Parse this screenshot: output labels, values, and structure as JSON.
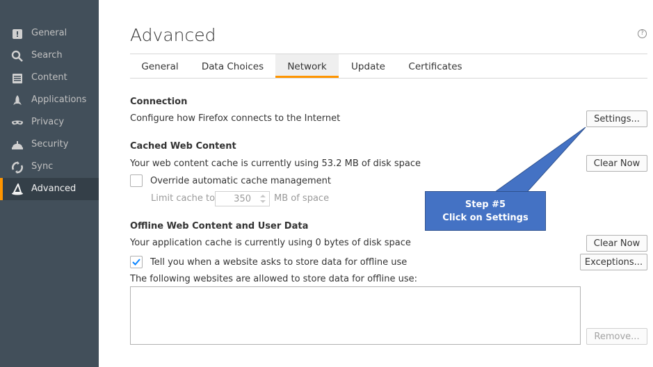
{
  "sidebar": {
    "items": [
      {
        "label": "General",
        "icon": "general-icon"
      },
      {
        "label": "Search",
        "icon": "search-icon"
      },
      {
        "label": "Content",
        "icon": "content-icon"
      },
      {
        "label": "Applications",
        "icon": "rocket-icon"
      },
      {
        "label": "Privacy",
        "icon": "mask-icon"
      },
      {
        "label": "Security",
        "icon": "helmet-icon"
      },
      {
        "label": "Sync",
        "icon": "sync-icon"
      },
      {
        "label": "Advanced",
        "icon": "wizard-hat-icon",
        "active": true
      }
    ]
  },
  "page": {
    "title": "Advanced",
    "help_glyph": "?"
  },
  "tabs": [
    {
      "label": "General"
    },
    {
      "label": "Data Choices"
    },
    {
      "label": "Network",
      "active": true
    },
    {
      "label": "Update"
    },
    {
      "label": "Certificates"
    }
  ],
  "connection": {
    "heading": "Connection",
    "description": "Configure how Firefox connects to the Internet",
    "settings_button": "Settings..."
  },
  "cached": {
    "heading": "Cached Web Content",
    "description": "Your web content cache is currently using 53.2 MB of disk space",
    "clear_button": "Clear Now",
    "override_label": "Override automatic cache management",
    "override_checked": false,
    "limit_label": "Limit cache to",
    "limit_value": "350",
    "limit_unit": "MB of space"
  },
  "offline": {
    "heading": "Offline Web Content and User Data",
    "description": "Your application cache is currently using 0 bytes of disk space",
    "clear_button": "Clear Now",
    "tell_label": "Tell you when a website asks to store data for offline use",
    "tell_checked": true,
    "exceptions_button": "Exceptions...",
    "allowed_label": "The following websites are allowed to store data for offline use:",
    "remove_button": "Remove..."
  },
  "annotation": {
    "line1": "Step #5",
    "line2": "Click on Settings"
  },
  "colors": {
    "sidebar_bg": "#424f5a",
    "accent": "#ff9500",
    "callout": "#4472c4"
  }
}
